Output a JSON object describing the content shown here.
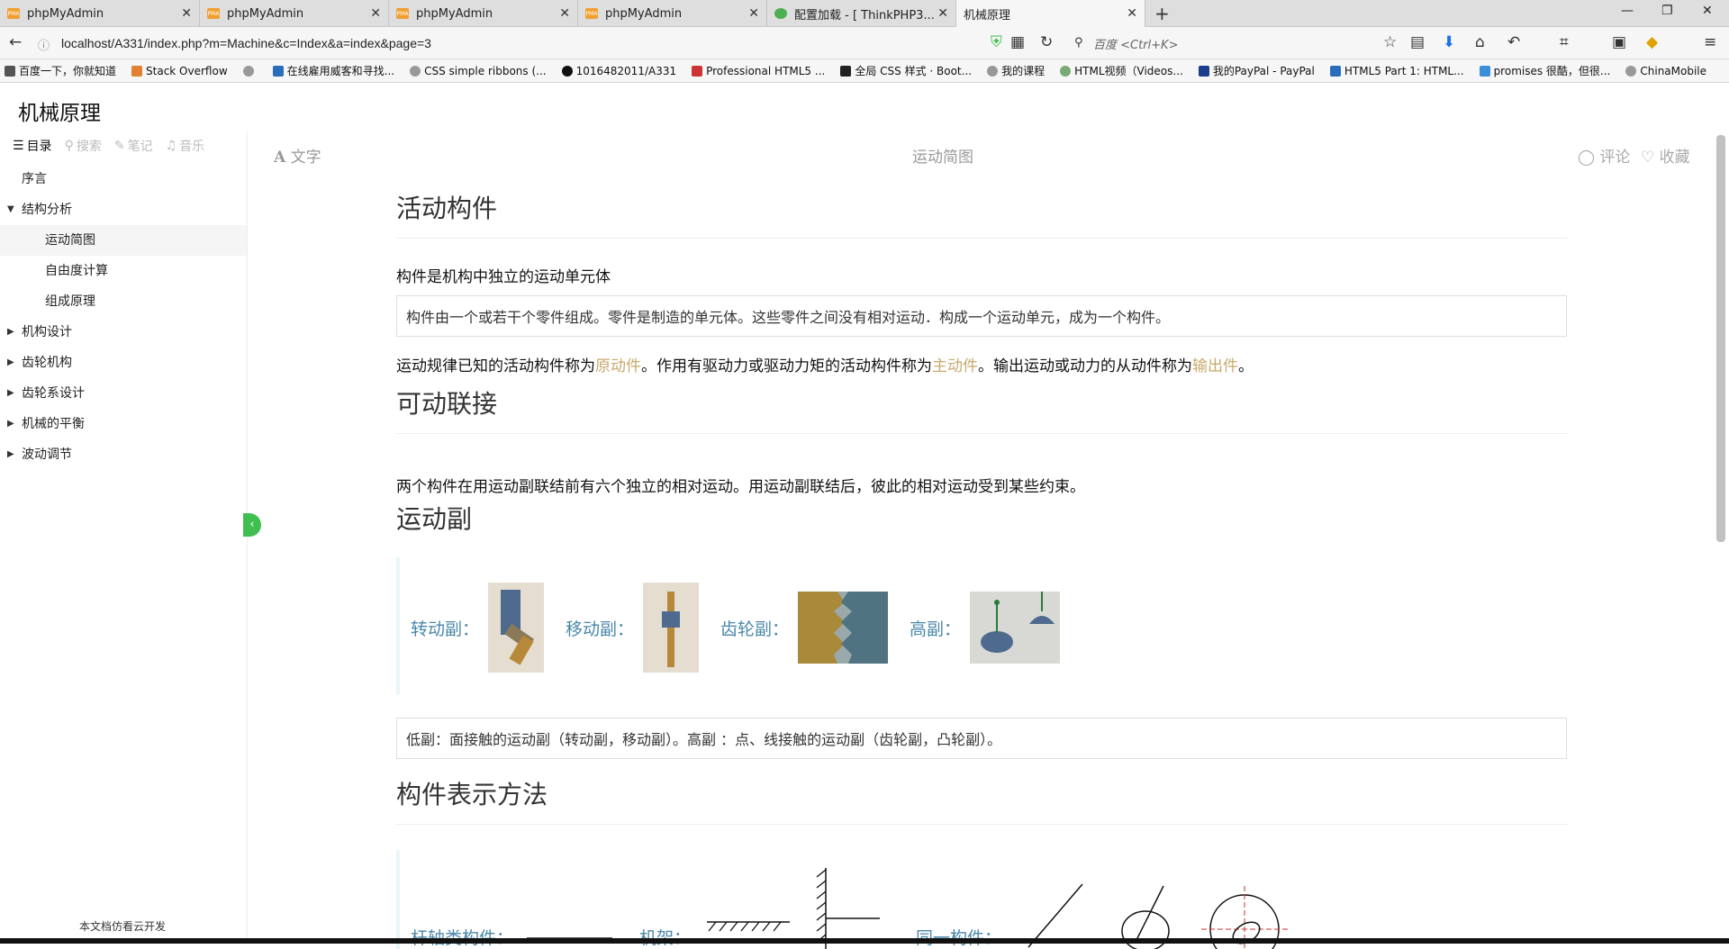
{
  "tabs": [
    {
      "label": "phpMyAdmin",
      "icon": "pma-icon"
    },
    {
      "label": "phpMyAdmin",
      "icon": "pma-icon"
    },
    {
      "label": "phpMyAdmin",
      "icon": "pma-icon"
    },
    {
      "label": "phpMyAdmin",
      "icon": "pma-icon"
    },
    {
      "label": "配置加载 - [ ThinkPHP3...",
      "icon": "thinkphp-icon"
    },
    {
      "label": "机械原理",
      "icon": "none"
    }
  ],
  "url": "localhost/A331/index.php?m=Machine&c=Index&a=index&page=3",
  "search_placeholder": "百度 <Ctrl+K>",
  "bookmarks": [
    "百度一下，你就知道",
    "Stack Overflow",
    "",
    "在线雇用威客和寻找...",
    "CSS simple ribbons (...",
    "1016482011/A331",
    "Professional HTML5 ...",
    "全局 CSS 样式 · Boot...",
    "我的课程",
    "HTML视频（Videos...",
    "我的PayPal - PayPal",
    "HTML5 Part 1: HTML...",
    "promises 很酷，但很...",
    "ChinaMobile"
  ],
  "site_title": "机械原理",
  "side_tabs": [
    "目录",
    "搜索",
    "笔记",
    "音乐"
  ],
  "nav": {
    "preface": "序言",
    "structure": "结构分析",
    "sub1": "运动简图",
    "sub2": "自由度计算",
    "sub3": "组成原理",
    "design": "机构设计",
    "gear": "齿轮机构",
    "geartrain": "齿轮系设计",
    "balance": "机械的平衡",
    "fluct": "波动调节"
  },
  "footer_note": "本文档仿看云开发",
  "toolbar": {
    "font": "文字",
    "page_title": "运动简图",
    "comment": "评论",
    "favorite": "收藏"
  },
  "content": {
    "h1": "活动构件",
    "lead1": "构件是机构中独立的运动单元体",
    "box1": "构件由一个或若干个零件组成。零件是制造的单元体。这些零件之间没有相对运动．构成一个运动单元，成为一个构件。",
    "lead2_a": "运动规律已知的活动构件称为",
    "lead2_h1": "原动件",
    "lead2_b": "。作用有驱动力或驱动力矩的活动构件称为",
    "lead2_h2": "主动件",
    "lead2_c": "。输出运动或动力的从动件称为",
    "lead2_h3": "输出件",
    "lead2_d": "。",
    "h2": "可动联接",
    "lead3": "两个构件在用运动副联结前有六个独立的相对运动。用运动副联结后，彼此的相对运动受到某些约束。",
    "h3": "运动副",
    "pairs": [
      "转动副：",
      "移动副：",
      "齿轮副：",
      "高副："
    ],
    "box2": "低副：面接触的运动副（转动副，移动副）。高副 ：点、线接触的运动副（齿轮副，凸轮副）。",
    "h4": "构件表示方法",
    "reprs": [
      "杆轴类构件：",
      "机架：",
      "同一构件："
    ]
  },
  "colors": {
    "accent": "#3fbf4f",
    "pair_label": "#4a88aa",
    "highlight": "#c9a96e"
  }
}
